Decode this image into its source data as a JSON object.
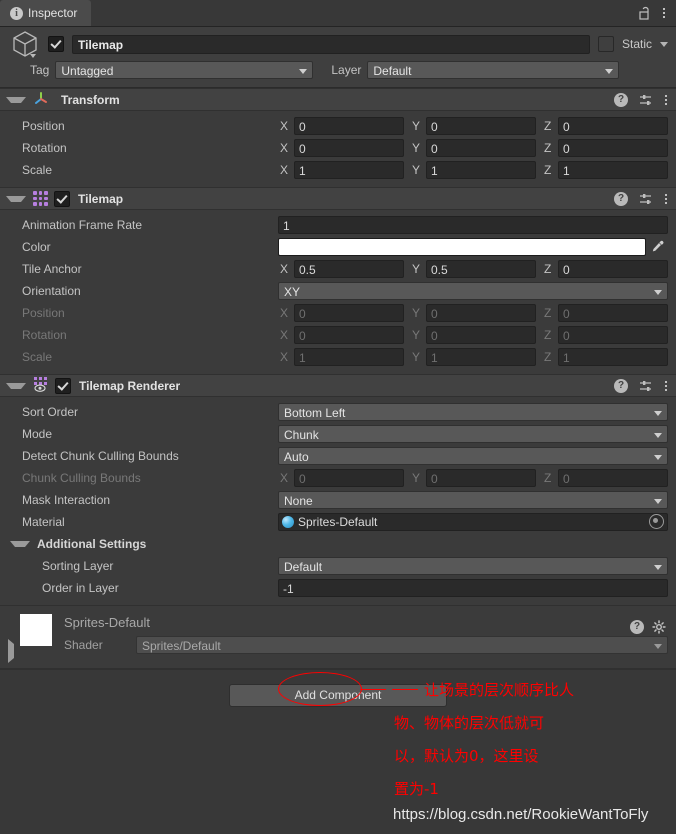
{
  "window": {
    "tab_label": "Inspector",
    "tab_icon": "info-icon",
    "lock_icon": "lock-open-icon",
    "menu_icon": "kebab-menu-icon"
  },
  "gameobject": {
    "icon": "cube-icon",
    "enabled": true,
    "name": "Tilemap",
    "static_label": "Static",
    "static_checked": false,
    "tag_label": "Tag",
    "tag_value": "Untagged",
    "layer_label": "Layer",
    "layer_value": "Default"
  },
  "components": [
    {
      "id": "transform",
      "title": "Transform",
      "icon": "transform-axis-icon",
      "has_checkbox": false,
      "expanded": true,
      "rows": [
        {
          "label": "Position",
          "type": "vector3",
          "axes": [
            "X",
            "Y",
            "Z"
          ],
          "values": [
            "0",
            "0",
            "0"
          ],
          "dim": false
        },
        {
          "label": "Rotation",
          "type": "vector3",
          "axes": [
            "X",
            "Y",
            "Z"
          ],
          "values": [
            "0",
            "0",
            "0"
          ],
          "dim": false
        },
        {
          "label": "Scale",
          "type": "vector3",
          "axes": [
            "X",
            "Y",
            "Z"
          ],
          "values": [
            "1",
            "1",
            "1"
          ],
          "dim": false
        }
      ]
    },
    {
      "id": "tilemap",
      "title": "Tilemap",
      "icon": "tilemap-grid-icon",
      "has_checkbox": true,
      "enabled": true,
      "expanded": true,
      "rows": [
        {
          "label": "Animation Frame Rate",
          "type": "text",
          "value": "1",
          "dim": false
        },
        {
          "label": "Color",
          "type": "color",
          "value": "#FFFFFF",
          "dim": false
        },
        {
          "label": "Tile Anchor",
          "type": "vector3",
          "axes": [
            "X",
            "Y",
            "Z"
          ],
          "values": [
            "0.5",
            "0.5",
            "0"
          ],
          "dim": false
        },
        {
          "label": "Orientation",
          "type": "popup",
          "value": "XY",
          "dim": false
        },
        {
          "label": "Position",
          "type": "vector3",
          "axes": [
            "X",
            "Y",
            "Z"
          ],
          "values": [
            "0",
            "0",
            "0"
          ],
          "dim": true
        },
        {
          "label": "Rotation",
          "type": "vector3",
          "axes": [
            "X",
            "Y",
            "Z"
          ],
          "values": [
            "0",
            "0",
            "0"
          ],
          "dim": true
        },
        {
          "label": "Scale",
          "type": "vector3",
          "axes": [
            "X",
            "Y",
            "Z"
          ],
          "values": [
            "1",
            "1",
            "1"
          ],
          "dim": true
        }
      ]
    },
    {
      "id": "tilemap-renderer",
      "title": "Tilemap Renderer",
      "icon": "tilemap-renderer-icon",
      "has_checkbox": true,
      "enabled": true,
      "expanded": true,
      "rows": [
        {
          "label": "Sort Order",
          "type": "popup",
          "value": "Bottom Left",
          "dim": false
        },
        {
          "label": "Mode",
          "type": "popup",
          "value": "Chunk",
          "dim": false
        },
        {
          "label": "Detect Chunk Culling Bounds",
          "type": "popup",
          "value": "Auto",
          "dim": false
        },
        {
          "label": "Chunk Culling Bounds",
          "type": "vector3",
          "axes": [
            "X",
            "Y",
            "Z"
          ],
          "values": [
            "0",
            "0",
            "0"
          ],
          "dim": true
        },
        {
          "label": "Mask Interaction",
          "type": "popup",
          "value": "None",
          "dim": false
        },
        {
          "label": "Material",
          "type": "object",
          "value": "Sprites-Default",
          "dim": false
        },
        {
          "label": "Additional Settings",
          "type": "foldout-header",
          "value": "",
          "dim": false
        },
        {
          "label": "Sorting Layer",
          "type": "popup",
          "value": "Default",
          "dim": false,
          "indent": true
        },
        {
          "label": "Order in Layer",
          "type": "text",
          "value": "-1",
          "dim": false,
          "indent": true
        }
      ]
    }
  ],
  "material_preview": {
    "name": "Sprites-Default",
    "shader_label": "Shader",
    "shader_value": "Sprites/Default",
    "swatch_color": "#FFFFFF",
    "help_icon": "help-icon",
    "gear_icon": "gear-icon",
    "foldout_icon": "triangle-right-icon"
  },
  "footer": {
    "add_component_label": "Add Component"
  },
  "annotation": {
    "color": "#FF0000",
    "line1": "让场景的层次顺序比人",
    "line2": "物、物体的层次低就可",
    "line3": "以，默认为0，这里设",
    "line4": "置为-1",
    "highlight_target": "-1"
  },
  "watermark": {
    "text": "https://blog.csdn.net/RookieWantToFly"
  }
}
